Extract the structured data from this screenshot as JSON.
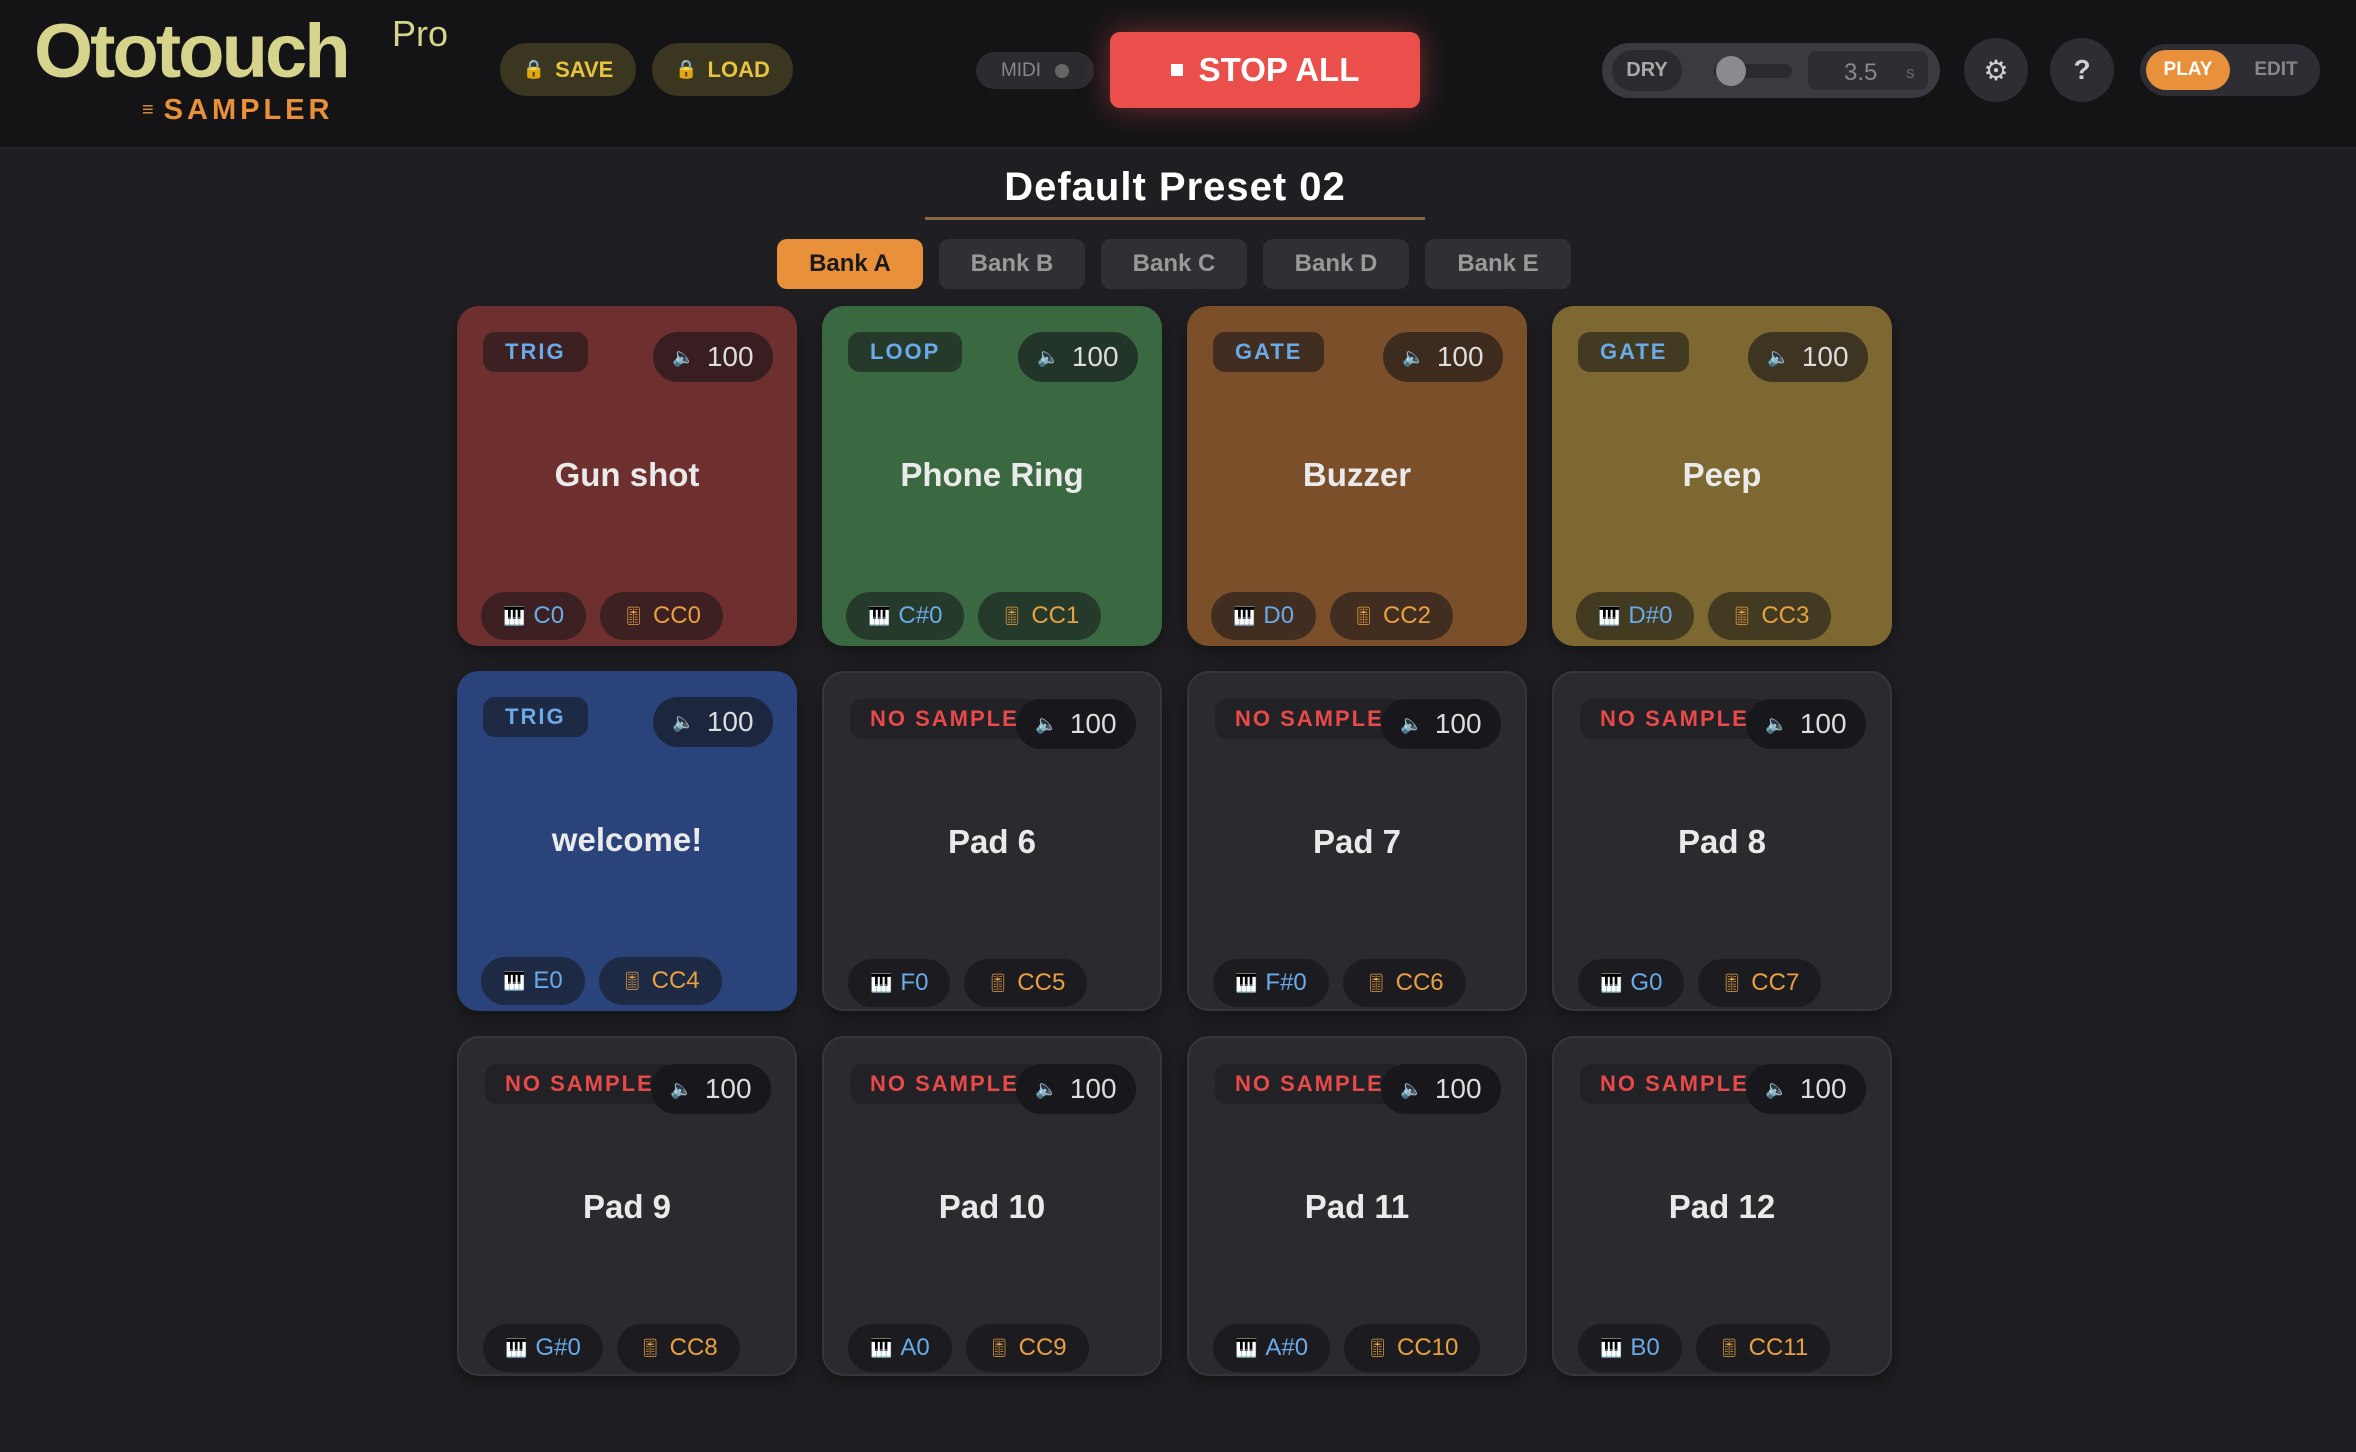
{
  "header": {
    "logo_main": "Ototouch",
    "logo_pro": "Pro",
    "logo_sub_icon": "≡",
    "logo_sub": "SAMPLER",
    "save_label": "SAVE",
    "load_label": "LOAD",
    "lock_icon": "🔒",
    "midi_label": "MIDI",
    "stop_all_label": "STOP ALL",
    "reverb": {
      "dry_label": "DRY",
      "value": "3.5",
      "unit": "s",
      "mix": 0.05
    },
    "settings_icon": "⚙",
    "help_icon": "?",
    "mode": {
      "play_label": "PLAY",
      "edit_label": "EDIT",
      "active": "PLAY"
    }
  },
  "preset": {
    "title": "Default Preset 02"
  },
  "banks": [
    {
      "label": "Bank A",
      "active": true
    },
    {
      "label": "Bank B",
      "active": false
    },
    {
      "label": "Bank C",
      "active": false
    },
    {
      "label": "Bank D",
      "active": false
    },
    {
      "label": "Bank E",
      "active": false
    }
  ],
  "icons": {
    "speaker": "🔈",
    "note": "🎹",
    "cc": "🎚"
  },
  "pads": [
    {
      "mode": "TRIG",
      "volume": "100",
      "name": "Gun shot",
      "note": "C0",
      "cc": "CC0",
      "color": "#6e2f2f"
    },
    {
      "mode": "LOOP",
      "volume": "100",
      "name": "Phone Ring",
      "note": "C#0",
      "cc": "CC1",
      "color": "#3a6841"
    },
    {
      "mode": "GATE",
      "volume": "100",
      "name": "Buzzer",
      "note": "D0",
      "cc": "CC2",
      "color": "#7a4f2a"
    },
    {
      "mode": "GATE",
      "volume": "100",
      "name": "Peep",
      "note": "D#0",
      "cc": "CC3",
      "color": "#7c6830"
    },
    {
      "mode": "TRIG",
      "volume": "100",
      "name": "welcome!",
      "note": "E0",
      "cc": "CC4",
      "color": "#2a437a"
    },
    {
      "mode": "NO SAMPLE",
      "volume": "100",
      "name": "Pad 6",
      "note": "F0",
      "cc": "CC5",
      "color": ""
    },
    {
      "mode": "NO SAMPLE",
      "volume": "100",
      "name": "Pad 7",
      "note": "F#0",
      "cc": "CC6",
      "color": ""
    },
    {
      "mode": "NO SAMPLE",
      "volume": "100",
      "name": "Pad 8",
      "note": "G0",
      "cc": "CC7",
      "color": ""
    },
    {
      "mode": "NO SAMPLE",
      "volume": "100",
      "name": "Pad 9",
      "note": "G#0",
      "cc": "CC8",
      "color": ""
    },
    {
      "mode": "NO SAMPLE",
      "volume": "100",
      "name": "Pad 10",
      "note": "A0",
      "cc": "CC9",
      "color": ""
    },
    {
      "mode": "NO SAMPLE",
      "volume": "100",
      "name": "Pad 11",
      "note": "A#0",
      "cc": "CC10",
      "color": ""
    },
    {
      "mode": "NO SAMPLE",
      "volume": "100",
      "name": "Pad 12",
      "note": "B0",
      "cc": "CC11",
      "color": ""
    }
  ]
}
